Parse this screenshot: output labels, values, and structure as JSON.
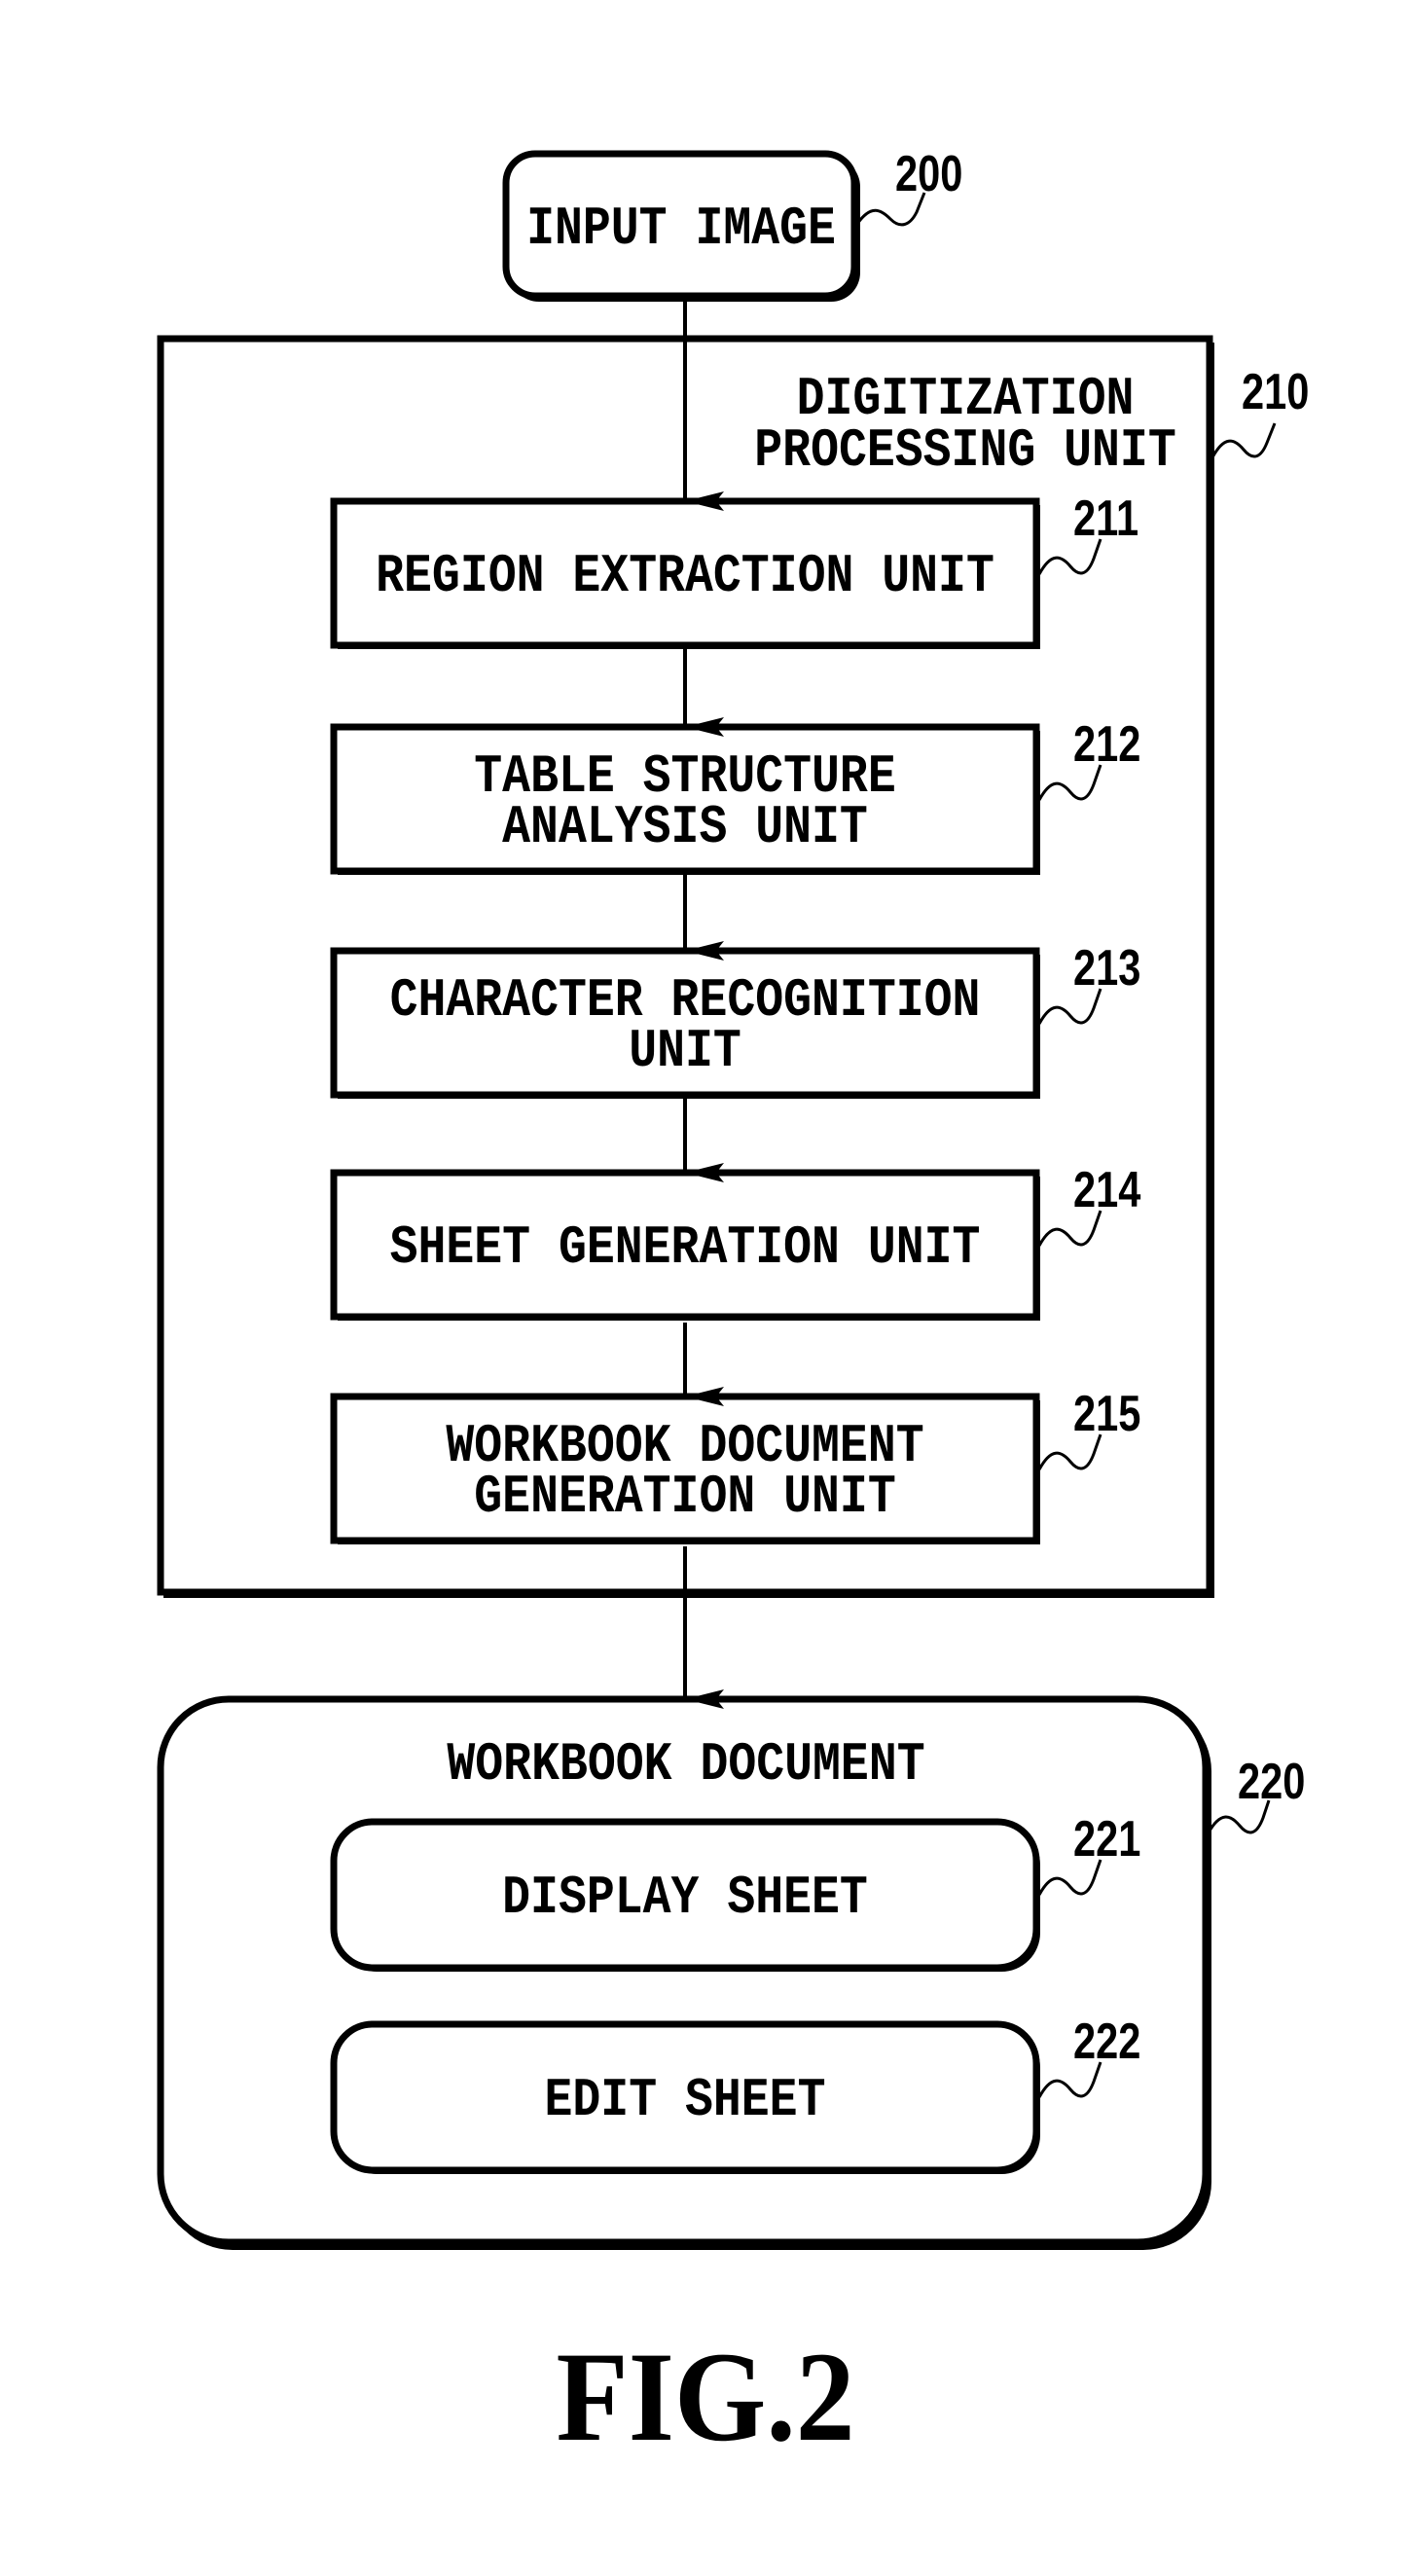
{
  "figure": {
    "caption": "FIG.2",
    "input": {
      "label": "INPUT IMAGE",
      "ref": "200"
    },
    "digitization_unit": {
      "title_lines": [
        "DIGITIZATION",
        "PROCESSING UNIT"
      ],
      "ref": "210",
      "units": [
        {
          "lines": [
            "REGION EXTRACTION UNIT"
          ],
          "ref": "211"
        },
        {
          "lines": [
            "TABLE STRUCTURE",
            "ANALYSIS UNIT"
          ],
          "ref": "212"
        },
        {
          "lines": [
            "CHARACTER RECOGNITION",
            "UNIT"
          ],
          "ref": "213"
        },
        {
          "lines": [
            "SHEET GENERATION UNIT"
          ],
          "ref": "214"
        },
        {
          "lines": [
            "WORKBOOK DOCUMENT",
            "GENERATION UNIT"
          ],
          "ref": "215"
        }
      ]
    },
    "workbook_document": {
      "title": "WORKBOOK DOCUMENT",
      "ref": "220",
      "sheets": [
        {
          "label": "DISPLAY SHEET",
          "ref": "221"
        },
        {
          "label": "EDIT SHEET",
          "ref": "222"
        }
      ]
    }
  }
}
